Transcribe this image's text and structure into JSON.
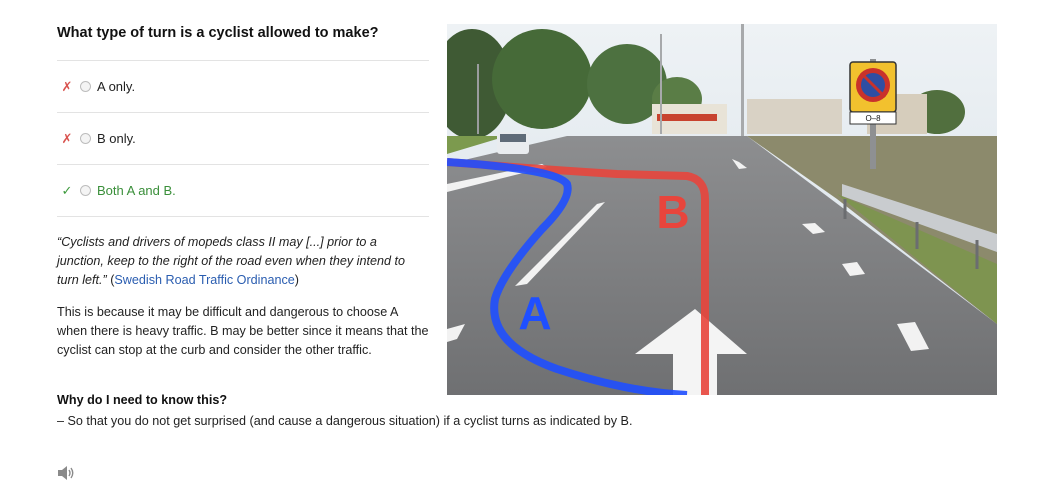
{
  "question": "What type of turn is a cyclist allowed to make?",
  "answers": [
    {
      "mark": "✗",
      "label": "A only."
    },
    {
      "mark": "✗",
      "label": "B only."
    },
    {
      "mark": "✓",
      "label": "Both A and B."
    }
  ],
  "quote": {
    "text": "“Cyclists and drivers of mopeds class II may [...] prior to a junction, keep to the right of the road even when they intend to turn left.”",
    "source_open": " (",
    "source_link": "Swedish Road Traffic Ordinance",
    "source_close": ")"
  },
  "explanation": "This is because it may be difficult and dangerous to choose A when there is heavy traffic. B may be better since it means that the cyclist can stop at the curb and consider the other traffic.",
  "why": {
    "title": "Why do I need to know this?",
    "text": "– So that you do not get surprised (and cause a dangerous situation) if a cyclist turns as indicated by B."
  },
  "image": {
    "label_a": "A",
    "label_b": "B",
    "sign_text": "O–8",
    "colors": {
      "path_a": "#1f4fff",
      "path_b": "#e8453c",
      "sky": "#dfe8ef",
      "asphalt": "#7d7e80"
    }
  },
  "icons": {
    "speaker": "speaker-icon",
    "wrong": "cross-icon",
    "right": "check-icon"
  }
}
